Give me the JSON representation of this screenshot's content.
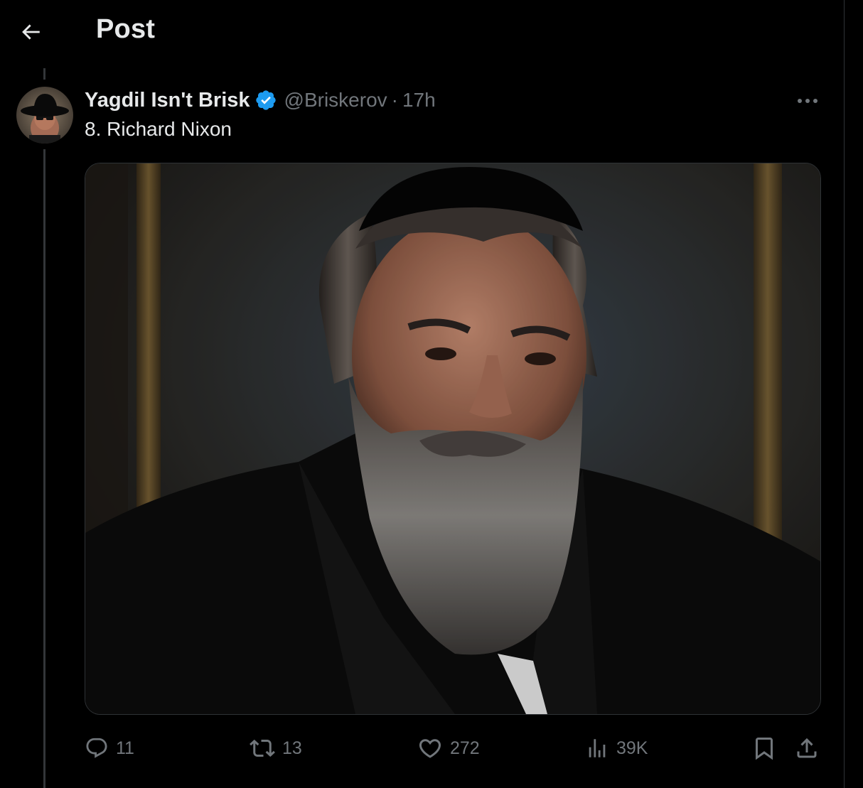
{
  "header": {
    "title": "Post",
    "back_icon": "arrow-left-icon"
  },
  "tweet": {
    "author": {
      "display_name": "Yagdil Isn't Brisk",
      "handle": "@Briskerov",
      "verified": true,
      "verified_color": "#1d9bf0"
    },
    "separator": "·",
    "timestamp": "17h",
    "text": "8. Richard Nixon",
    "media_description_icon": "portrait-image",
    "actions": {
      "replies": "11",
      "reposts": "13",
      "likes": "272",
      "views": "39K"
    }
  },
  "colors": {
    "background": "#000000",
    "text_primary": "#e7e9ea",
    "text_secondary": "#71767b",
    "divider": "#2f3336",
    "accent": "#1d9bf0"
  }
}
